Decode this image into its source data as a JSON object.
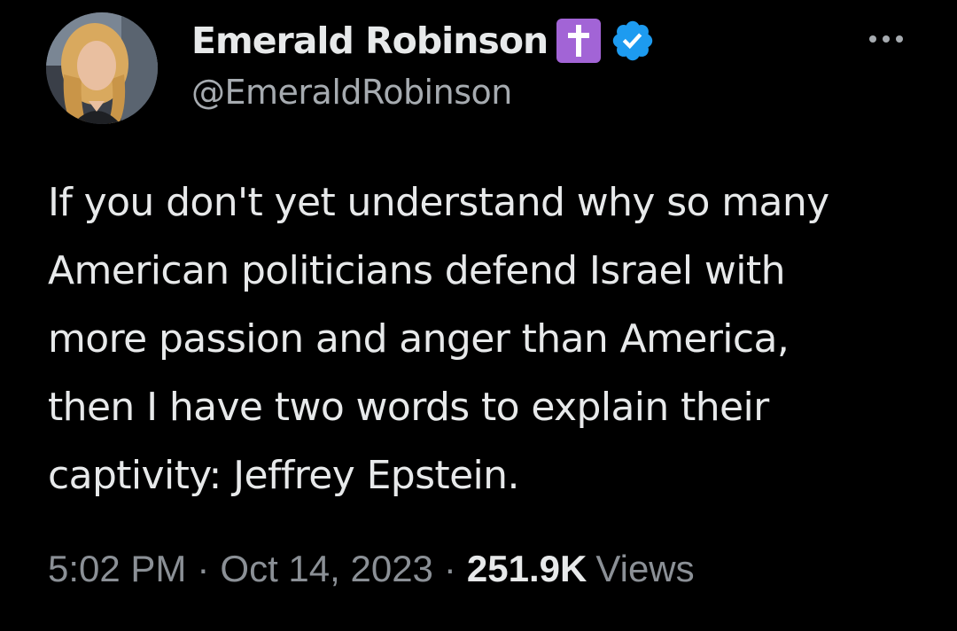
{
  "colors": {
    "background": "#000000",
    "primary_text": "#e7e9ea",
    "secondary_text": "#8b9096",
    "verified_blue": "#1d9bf0",
    "cross_badge_purple": "#a264d6"
  },
  "author": {
    "display_name": "Emerald Robinson",
    "handle": "@EmeraldRobinson",
    "avatar_icon": "profile-photo",
    "badges": [
      "cross-icon",
      "verified-badge-icon"
    ]
  },
  "more_icon": "more-options-icon",
  "tweet": {
    "lines": [
      "If you don't yet understand why so many",
      "American politicians defend Israel with",
      "more passion and anger than America,",
      "then I have two words to explain their",
      "captivity: Jeffrey Epstein."
    ]
  },
  "meta": {
    "time": "5:02 PM",
    "separator": "·",
    "date": "Oct 14, 2023",
    "views_count": "251.9K",
    "views_label": "Views"
  }
}
